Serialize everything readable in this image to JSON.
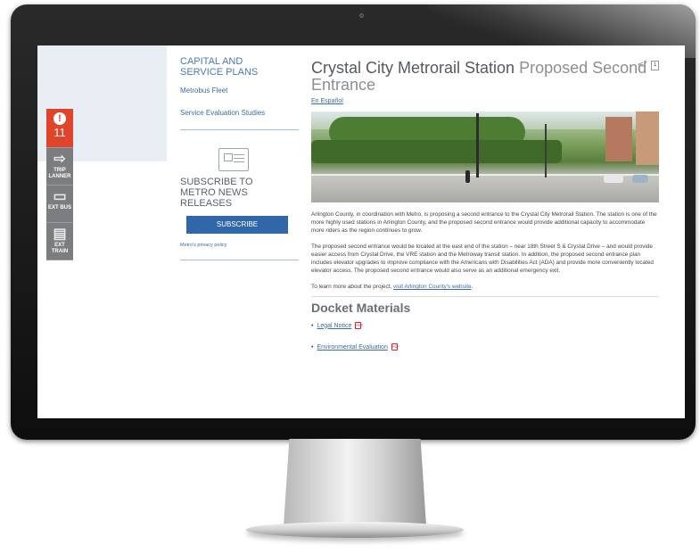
{
  "alerts": {
    "count": "11"
  },
  "side_tools": [
    {
      "label": "TRIP LANNER"
    },
    {
      "label": "EXT BUS"
    },
    {
      "label": "EXT TRAIN"
    }
  ],
  "sidebar": {
    "heading": "CAPITAL AND SERVICE PLANS",
    "links": [
      "Metrobus Fleet",
      "Service Evaluation Studies"
    ],
    "subscribe_heading": "SUBSCRIBE TO METRO NEWS RELEASES",
    "subscribe_button": "SUBSCRIBE",
    "privacy_link": "Metro's privacy policy"
  },
  "main": {
    "title_dark": "Crystal City Metrorail Station",
    "title_light": "Proposed Second Entrance",
    "espanol_link": "En Español",
    "print_label": "1",
    "para1": "Arlington County, in coordination with Metro, is proposing a second entrance to the Crystal City Metrorail Station. The station is one of the more highly used stations in Arlington County, and the proposed second entrance would provide additional capacity to accommodate more riders as the region continues to grow.",
    "para2": "The proposed second entrance would be located at the east end of the station – near 18th Street S & Crystal Drive – and would provide easier access from Crystal Drive, the VRE station and the Metroway transit station. In addition, the proposed second entrance plan includes elevator upgrades to improve compliance with the Americans with Disabilities Act (ADA) and provide more conveniently located elevator access. The proposed second entrance would also serve as an additional emergency exit.",
    "para3_prefix": "To learn more about the project, ",
    "para3_link": "visit Arlington County's website",
    "para3_suffix": ".",
    "docket_heading": "Docket Materials",
    "docket_items": [
      "Legal Notice",
      "Environmental Evaluation"
    ]
  },
  "icons": {
    "alert": "exclamation-icon",
    "trip_planner": "arrow-right-icon",
    "bus": "bus-icon",
    "train": "train-icon",
    "share": "share-icon",
    "pdf": "pdf-icon",
    "news": "newspaper-icon"
  },
  "colors": {
    "alert_red": "#e0442b",
    "link_blue": "#3a6ea5",
    "button_blue": "#2f67a8",
    "tool_gray": "#7b7d80"
  }
}
